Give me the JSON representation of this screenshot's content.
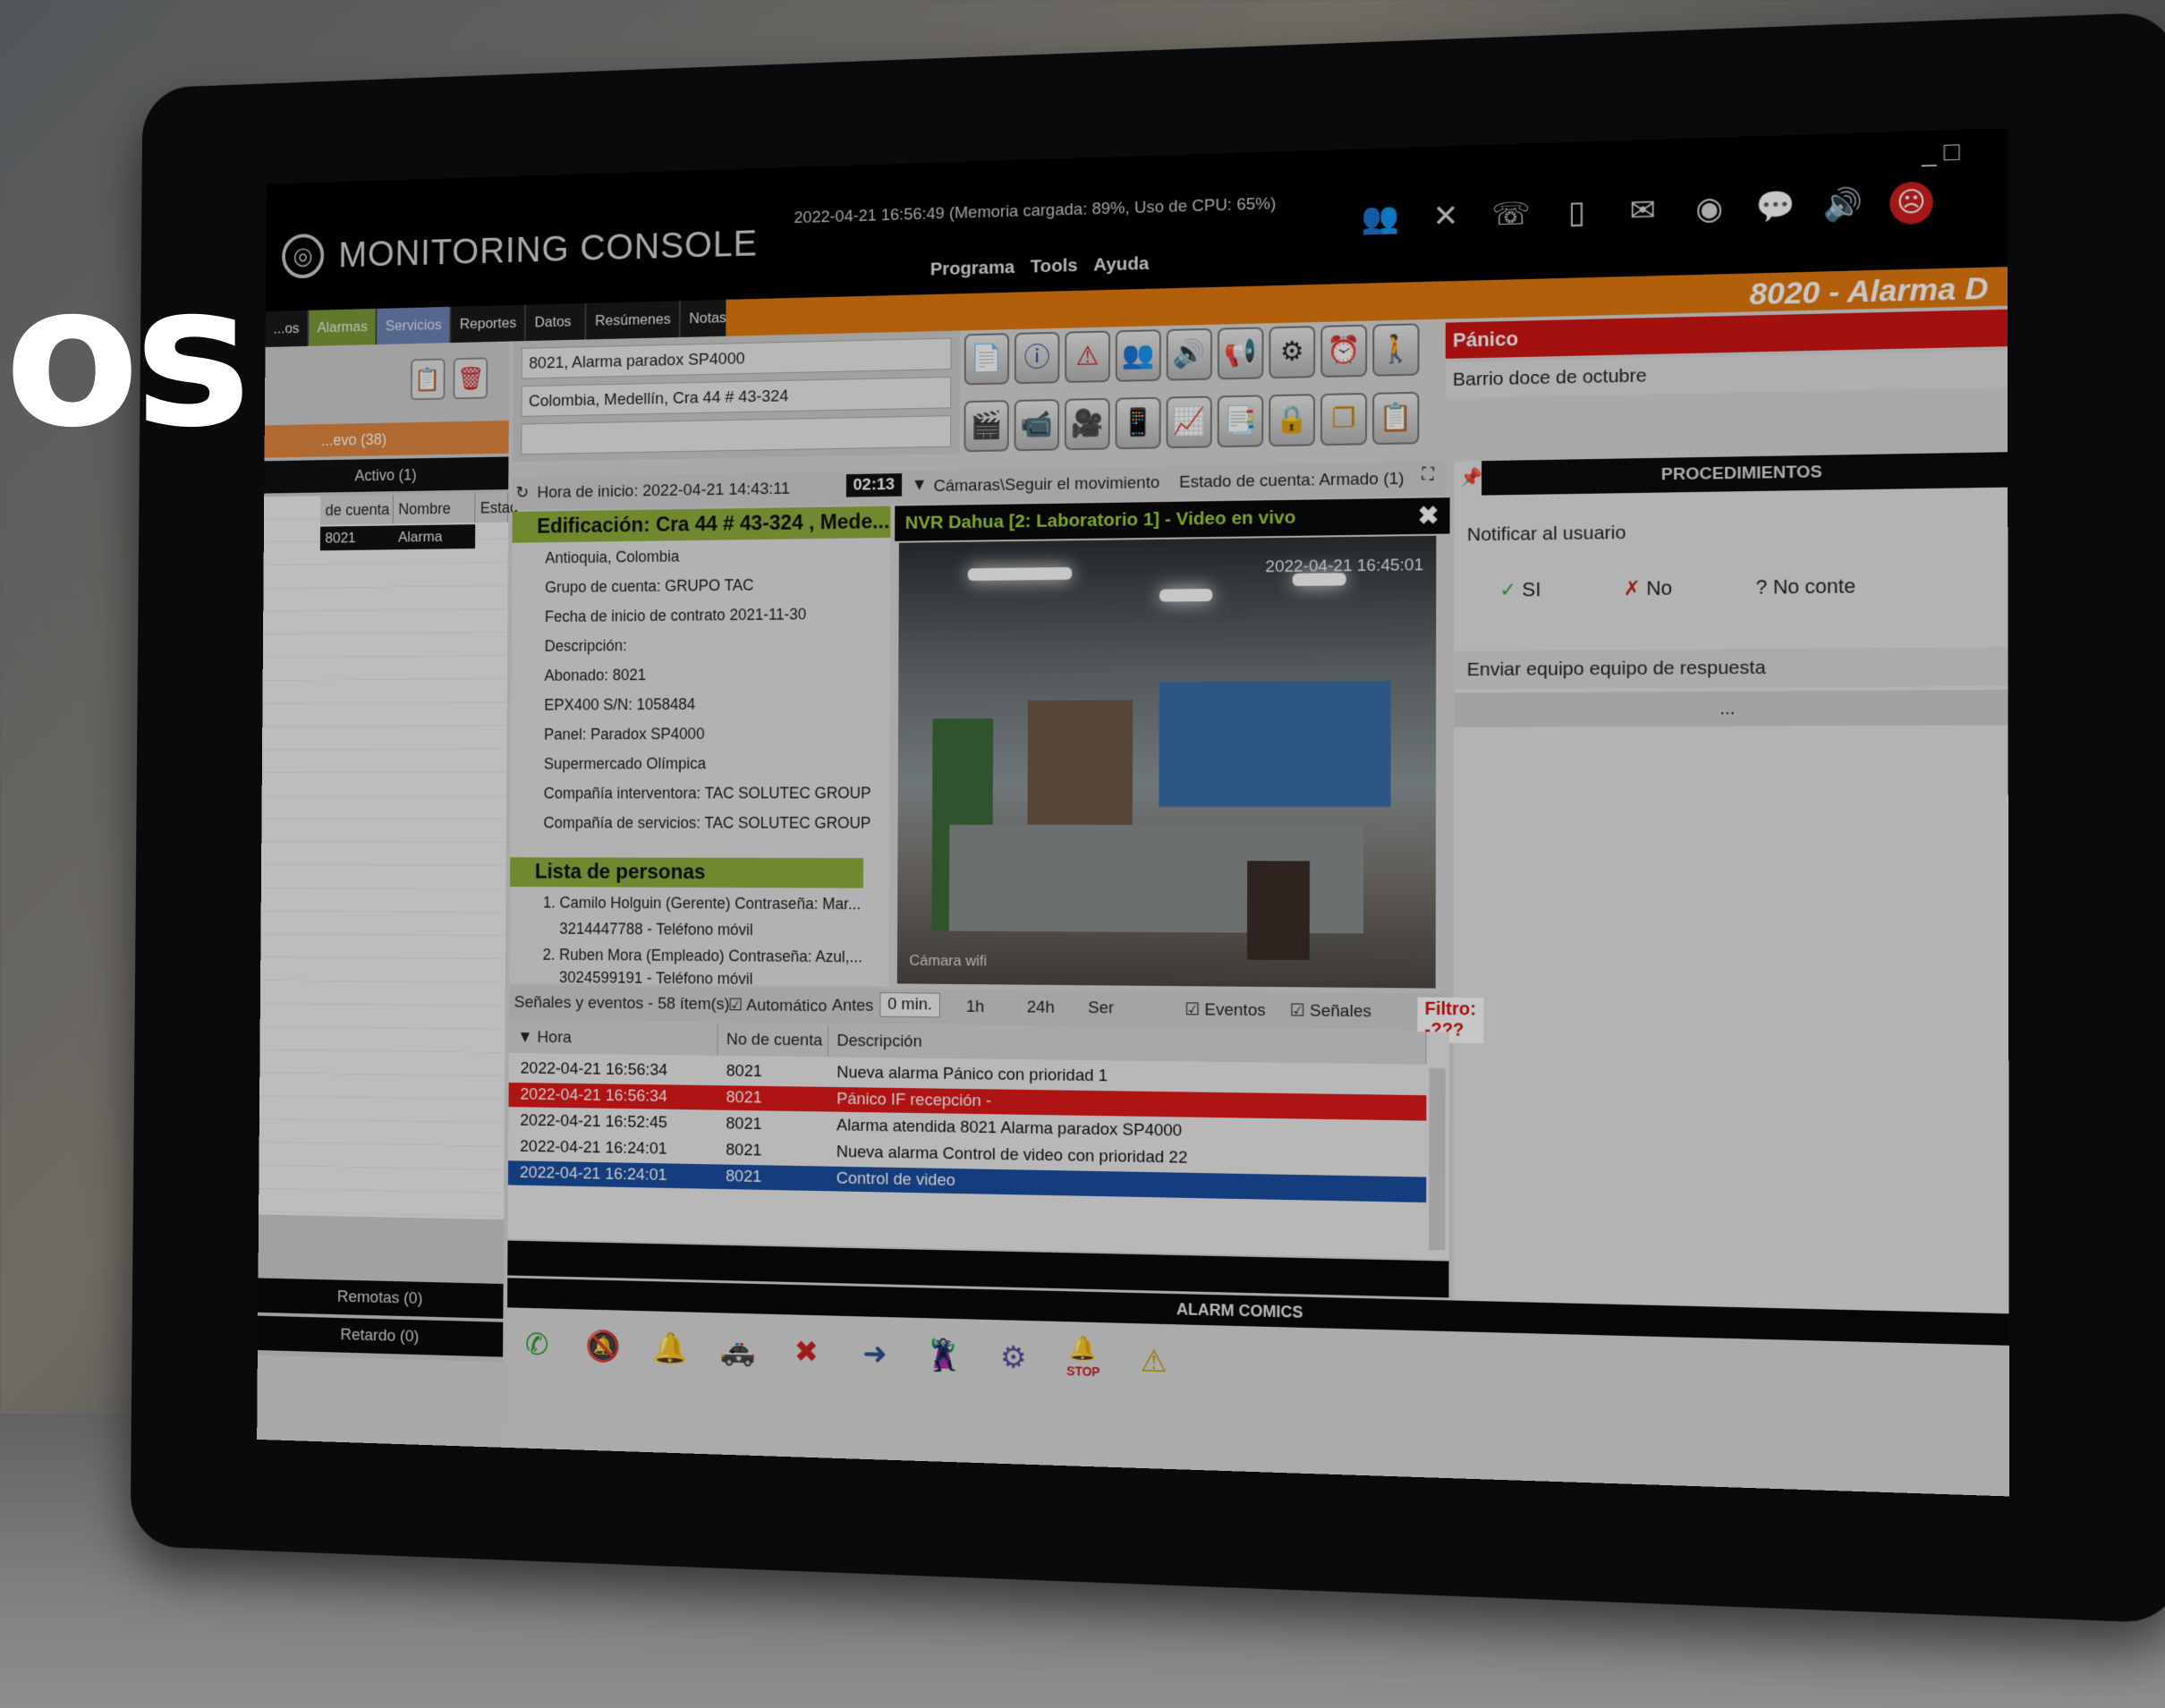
{
  "app": {
    "title": "MONITORING CONSOLE",
    "status_line": "2022-04-21 16:56:49 (Memoria cargada: 89%, Uso de CPU: 65%)",
    "menu": [
      "Programa",
      "Tools",
      "Ayuda"
    ],
    "window_controls": "_ □"
  },
  "top_icons": [
    "users-icon",
    "mute-icon",
    "phone-call-icon",
    "sms-icon",
    "email-icon",
    "owl-icon",
    "chat-icon",
    "speaker-icon",
    "sad-face-icon"
  ],
  "tabs": [
    "...os",
    "Alarmas",
    "Servicios",
    "Reportes",
    "Datos de cuenta",
    "Resúmenes",
    "Notas"
  ],
  "alarm_header": "8020 - Alarma D",
  "overlay_text": "os",
  "left_panel": {
    "nuevo": "...evo (38)",
    "activo": "Activo (1)",
    "columns": [
      "de cuenta",
      "Nombre",
      "Estad"
    ],
    "row": {
      "account": "8021",
      "name": "Alarma paradox"
    },
    "remotas": "Remotas (0)",
    "retardo": "Retardo (0)"
  },
  "account_info": {
    "name": "8021, Alarma paradox SP4000",
    "address": "Colombia, Medellín, Cra 44 # 43-324",
    "extra": ""
  },
  "alarm": {
    "type": "Pánico",
    "location": "Barrio doce de octubre"
  },
  "time_row": {
    "start": "Hora de inicio: 2022-04-21 14:43:11",
    "timer": "02:13",
    "camera_path": "Cámaras\\Seguir el movimiento",
    "account_state": "Estado de cuenta: Armado (1)"
  },
  "tree": {
    "header": "Edificación: Cra 44 # 43-324 , Mede...",
    "lines": [
      "Antioquia, Colombia",
      "Grupo de cuenta: GRUPO TAC",
      "Fecha de inicio de contrato 2021-11-30",
      "Descripción:",
      "Abonado: 8021",
      "EPX400 S/N: 1058484",
      "Panel: Paradox SP4000",
      "Supermercado Olímpica",
      "Compañía interventora: TAC SOLUTEC GROUP",
      "Compañía de servicios: TAC SOLUTEC GROUP"
    ],
    "persons_header": "Lista de personas",
    "persons": [
      "1. Camilo Holguin (Gerente) Contraseña: Mar...",
      "3214447788 - Teléfono móvil",
      "2. Ruben Mora (Empleado) Contraseña: Azul,...",
      "3024599191 - Teléfono móvil"
    ]
  },
  "video": {
    "title": "NVR Dahua [2: Laboratorio 1] - Video en vivo",
    "timestamp": "2022-04-21 16:45:01",
    "camera_label": "Cámara wifi"
  },
  "procedures": {
    "title": "PROCEDIMIENTOS",
    "step1": "Notificar al usuario",
    "yes": "SI",
    "no": "No",
    "unknown": "No conte",
    "step2": "Enviar equipo equipo de respuesta",
    "more": "..."
  },
  "events": {
    "label": "Señales y eventos - 58 ítem(s)",
    "auto": "Automático",
    "antes": "Antes",
    "minutes": "0 min.",
    "h1": "1h",
    "h24": "24h",
    "ser": "Ser",
    "eventos": "Eventos",
    "senales": "Señales",
    "filtro": "Filtro: -???",
    "columns": [
      "Hora",
      "No de cuenta",
      "Descripción"
    ],
    "rows": [
      {
        "time": "2022-04-21 16:56:34",
        "account": "8021",
        "desc": "Nueva alarma Pánico con prioridad 1",
        "style": "plain"
      },
      {
        "time": "2022-04-21 16:56:34",
        "account": "8021",
        "desc": "Pánico  IF recepción -",
        "style": "red"
      },
      {
        "time": "2022-04-21 16:52:45",
        "account": "8021",
        "desc": "Alarma atendida 8021 Alarma paradox SP4000",
        "style": "plain"
      },
      {
        "time": "2022-04-21 16:24:01",
        "account": "8021",
        "desc": "Nueva alarma Control de video con prioridad 22",
        "style": "plain"
      },
      {
        "time": "2022-04-21 16:24:01",
        "account": "8021",
        "desc": "Control de video",
        "style": "blue"
      }
    ]
  },
  "action_bar": {
    "title": "ALARM COMICS",
    "stop": "STOP"
  },
  "colors": {
    "accent_orange": "#e57a10",
    "alarm_red": "#d01515",
    "tree_green": "#90b03c",
    "video_green": "#9fd431",
    "row_blue": "#1c4fa0"
  }
}
